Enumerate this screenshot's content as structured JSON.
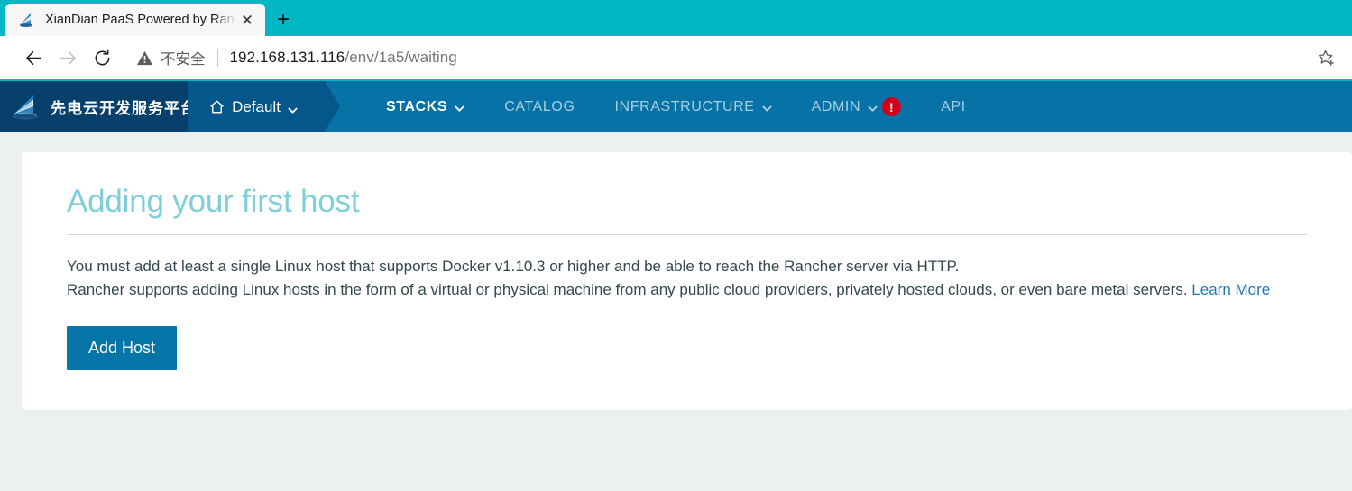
{
  "browser": {
    "tab": {
      "title": "XianDian PaaS Powered by Ranch",
      "favicon_name": "rancher-sail-favicon",
      "close_label": "✕"
    },
    "new_tab_label": "+",
    "toolbar": {
      "back_label": "←",
      "forward_label": "→",
      "reload_label": "↻",
      "security_icon": "warning-triangle-icon",
      "security_text": "不安全",
      "url_host": "192.168.131.116",
      "url_path": "/env/1a5/waiting",
      "bookmark_icon": "star-plus-icon"
    },
    "accent_color": "#00b7c3"
  },
  "app_nav": {
    "brand_text": "先电云开发服务平台",
    "brand_logo_name": "xiandian-sail-logo",
    "environment": {
      "label": "Default",
      "home_icon": "home-icon",
      "caret_icon": "chevron-down-icon"
    },
    "items": [
      {
        "label": "STACKS",
        "active": true,
        "has_caret": true,
        "badge": null
      },
      {
        "label": "CATALOG",
        "active": false,
        "has_caret": false,
        "badge": null
      },
      {
        "label": "INFRASTRUCTURE",
        "active": false,
        "has_caret": true,
        "badge": null
      },
      {
        "label": "ADMIN",
        "active": false,
        "has_caret": true,
        "badge": "!"
      },
      {
        "label": "API",
        "active": false,
        "has_caret": false,
        "badge": null
      }
    ],
    "colors": {
      "brand_bg": "#06406b",
      "env_bg": "#05568a",
      "nav_bg": "#0672a5",
      "badge_bg": "#d0021b"
    }
  },
  "main": {
    "title": "Adding your first host",
    "paragraph_line_1": "You must add at least a single Linux host that supports Docker v1.10.3 or higher and be able to reach the Rancher server via HTTP.",
    "paragraph_line_2": "Rancher supports adding Linux hosts in the form of a virtual or physical machine from any public cloud providers, privately hosted clouds, or even bare metal servers.",
    "learn_more_label": "Learn More",
    "add_host_label": "Add Host",
    "title_color": "#7fcfd8",
    "button_color": "#0575a8",
    "link_color": "#1f77b4"
  }
}
